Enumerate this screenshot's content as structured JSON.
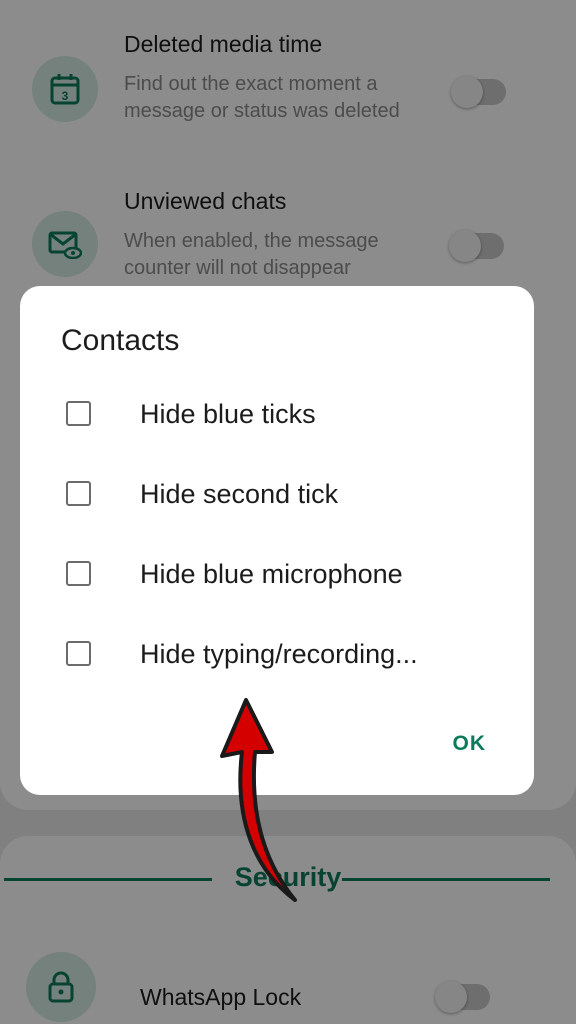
{
  "settings": {
    "items": [
      {
        "title": "Deleted media time",
        "description": "Find out the exact moment a message or status was deleted",
        "icon": "calendar-icon",
        "enabled": false
      },
      {
        "title": "Unviewed chats",
        "description": "When enabled, the message counter will not disappear",
        "icon": "mail-eye-icon",
        "enabled": false
      }
    ],
    "section_title": "Security",
    "security_items": [
      {
        "title": "WhatsApp Lock",
        "icon": "lock-icon",
        "enabled": false
      }
    ]
  },
  "dialog": {
    "title": "Contacts",
    "options": [
      {
        "label": "Hide blue ticks",
        "checked": false
      },
      {
        "label": "Hide second tick",
        "checked": false
      },
      {
        "label": "Hide blue microphone",
        "checked": false
      },
      {
        "label": "Hide typing/recording...",
        "checked": false
      }
    ],
    "ok_label": "OK"
  },
  "colors": {
    "accent": "#0d7a5a",
    "icon_bg": "#d6ece3",
    "arrow": "#d40000"
  }
}
